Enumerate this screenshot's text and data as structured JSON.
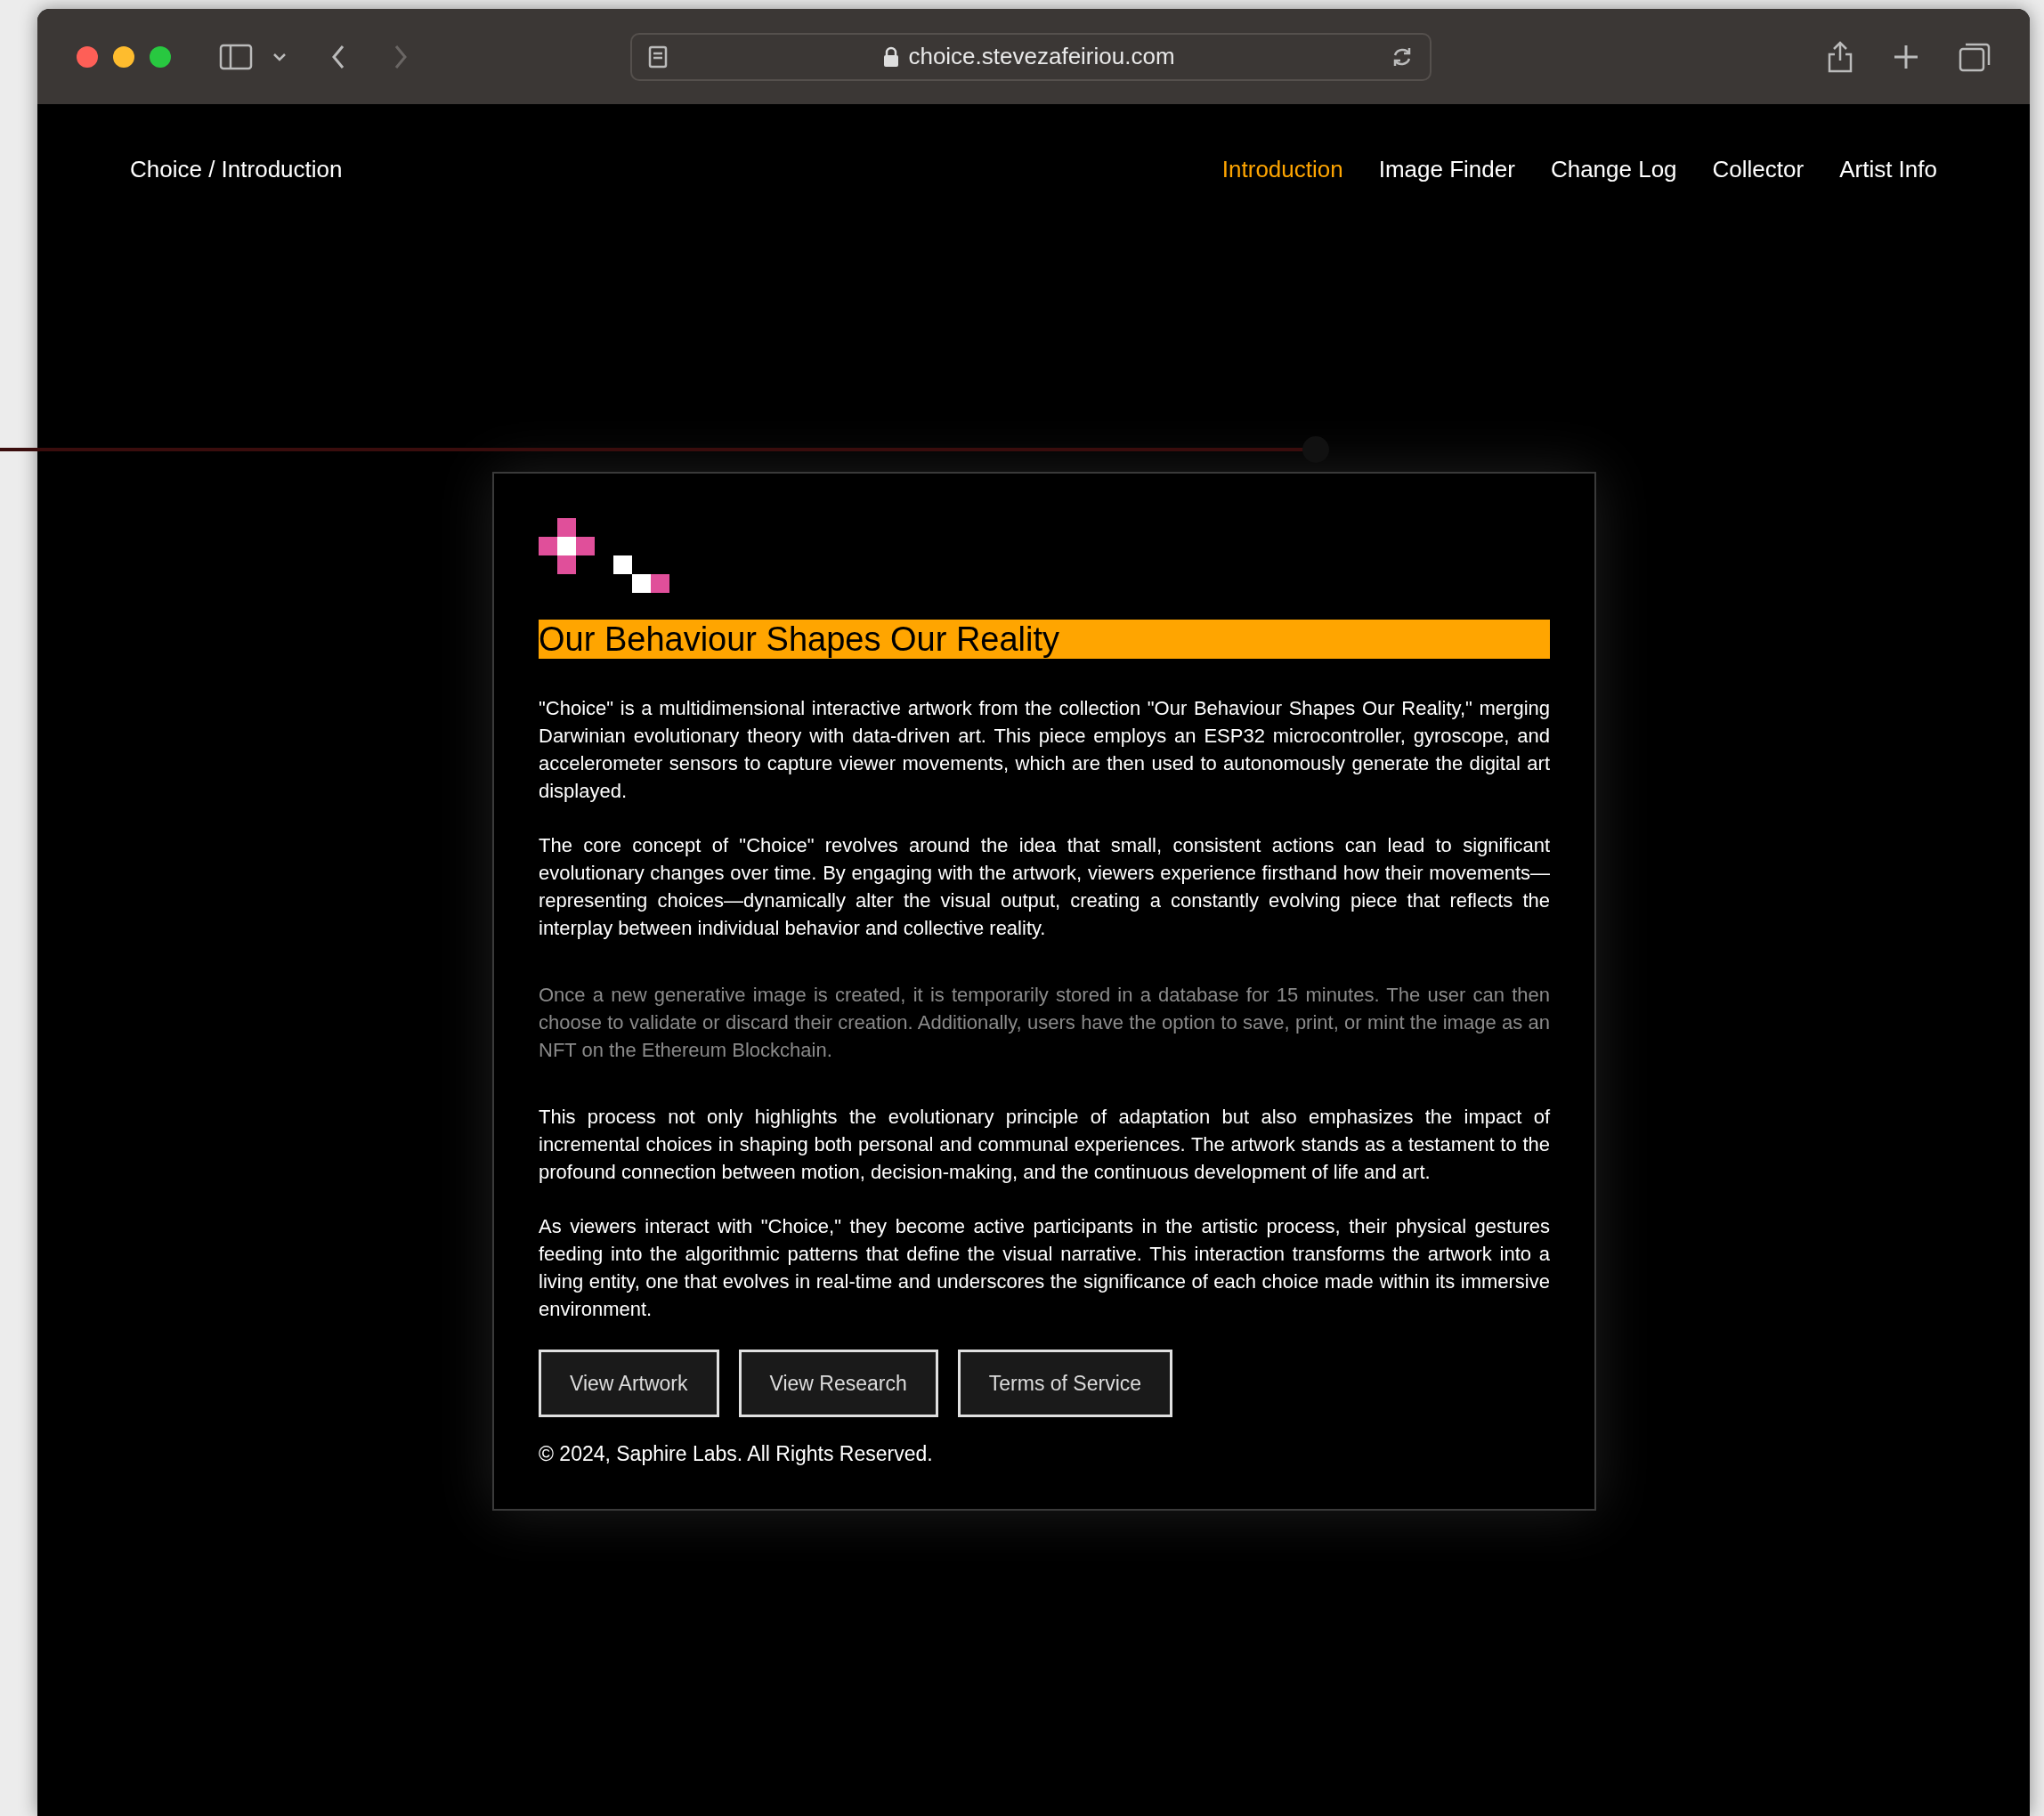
{
  "browser": {
    "url": "choice.stevezafeiriou.com"
  },
  "nav": {
    "brand": "Choice / Introduction",
    "links": [
      {
        "label": "Introduction",
        "selected": true
      },
      {
        "label": "Image Finder",
        "selected": false
      },
      {
        "label": "Change Log",
        "selected": false
      },
      {
        "label": "Collector",
        "selected": false
      },
      {
        "label": "Artist Info",
        "selected": false
      }
    ]
  },
  "card": {
    "heading": "Our Behaviour Shapes Our Reality",
    "paragraphs": [
      {
        "kind": "normal",
        "text": "\"Choice\" is a multidimensional interactive artwork from the collection \"Our Behaviour Shapes Our Reality,\" merging Darwinian evolutionary theory with data-driven art. This piece employs an ESP32 microcontroller, gyroscope, and accelerometer sensors to capture viewer movements, which are then used to autonomously generate the digital art displayed."
      },
      {
        "kind": "normal",
        "text": "The core concept of \"Choice\" revolves around the idea that small, consistent actions can lead to significant evolutionary changes over time. By engaging with the artwork, viewers experience firsthand how their movements—representing choices—dynamically alter the visual output, creating a constantly evolving piece that reflects the interplay between individual behavior and collective reality."
      },
      {
        "kind": "muted",
        "text": "Once a new generative image is created, it is temporarily stored in a database for 15 minutes. The user can then choose to validate or discard their creation. Additionally, users have the option to save, print, or mint the image as an NFT on the Ethereum Blockchain."
      },
      {
        "kind": "normal",
        "text": "This process not only highlights the evolutionary principle of adaptation but also emphasizes the impact of incremental choices in shaping both personal and communal experiences. The artwork stands as a testament to the profound connection between motion, decision-making, and the continuous development of life and art."
      },
      {
        "kind": "normal",
        "text": "As viewers interact with \"Choice,\" they become active participants in the artistic process, their physical gestures feeding into the algorithmic patterns that define the visual narrative. This interaction transforms the artwork into a living entity, one that evolves in real-time and underscores the significance of each choice made within its immersive environment."
      }
    ],
    "buttons": [
      "View Artwork",
      "View Research",
      "Terms of Service"
    ],
    "footer": "© 2024, Saphire Labs. All Rights Reserved."
  }
}
